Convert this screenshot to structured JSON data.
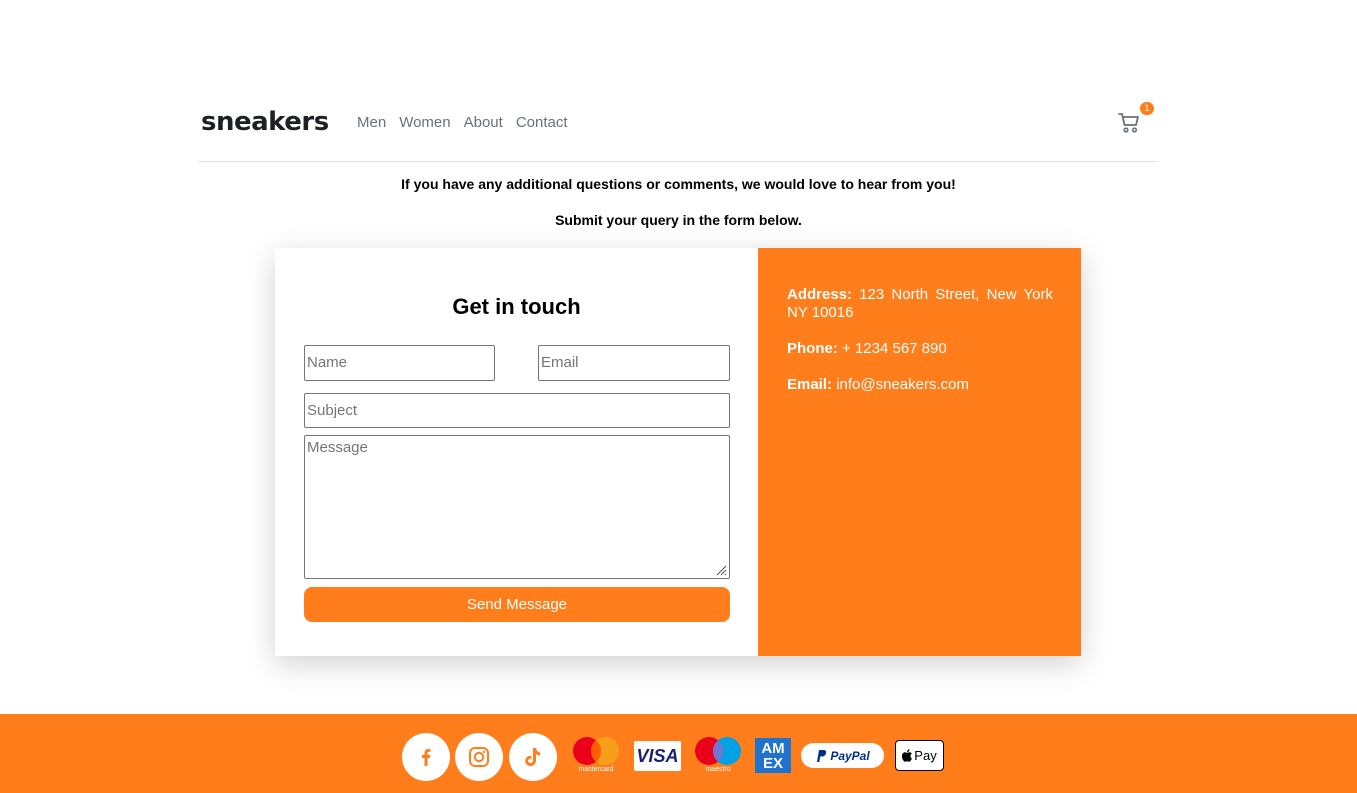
{
  "header": {
    "logo": "sneakers",
    "nav": [
      "Men",
      "Women",
      "About",
      "Contact"
    ],
    "cart_count": "1",
    "icons": {
      "cart": "cart-icon"
    }
  },
  "intro": {
    "line1": "If you have any additional questions or comments, we would love to hear from you!",
    "line2": "Submit your query in the form below."
  },
  "form": {
    "title": "Get in touch",
    "name_placeholder": "Name",
    "email_placeholder": "Email",
    "subject_placeholder": "Subject",
    "message_placeholder": "Message",
    "send_label": "Send Message"
  },
  "contact_info": {
    "address_label": "Address:",
    "address_value": "123 North Street, New York NY 10016",
    "phone_label": "Phone:",
    "phone_value": "+ 1234 567 890",
    "email_label": "Email:",
    "email_value": "info@sneakers.com"
  },
  "footer": {
    "social": [
      "facebook-icon",
      "instagram-icon",
      "tiktok-icon"
    ],
    "payments": {
      "mastercard": "mastercard",
      "visa": "VISA",
      "maestro": "maestro",
      "amex_top": "AM",
      "amex_bottom": "EX",
      "paypal": "PayPal",
      "applepay": "Pay"
    }
  },
  "colors": {
    "accent": "#ff7e1b",
    "text_dark": "#1d2025",
    "nav_text": "#69707d"
  }
}
